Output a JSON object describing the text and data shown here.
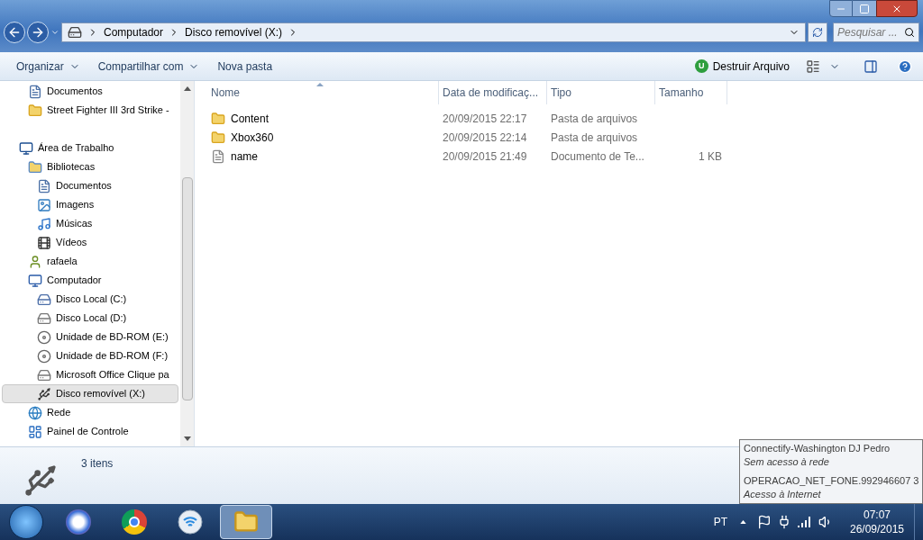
{
  "address_bar": {
    "breadcrumbs": [
      "Computador",
      "Disco removível (X:)"
    ],
    "search": {
      "placeholder": "Pesquisar ..."
    }
  },
  "toolbar": {
    "buttons": [
      {
        "label": "Organizar",
        "dropdown": true
      },
      {
        "label": "Compartilhar com",
        "dropdown": true
      },
      {
        "label": "Nova pasta",
        "dropdown": false
      }
    ],
    "extension": {
      "badge": "U",
      "label": "Destruir Arquivo"
    }
  },
  "navigation": {
    "pinned": [
      {
        "label": "Documentos",
        "kind": "document"
      },
      {
        "label": "Street Fighter III 3rd Strike - ",
        "kind": "folder"
      }
    ],
    "tree": [
      {
        "label": "Área de Trabalho",
        "kind": "desktop",
        "selected": false,
        "children": [
          {
            "label": "Bibliotecas",
            "kind": "library",
            "selected": false,
            "children": [
              {
                "label": "Documentos",
                "kind": "document",
                "selected": false
              },
              {
                "label": "Imagens",
                "kind": "image",
                "selected": false
              },
              {
                "label": "Músicas",
                "kind": "music",
                "selected": false
              },
              {
                "label": "Vídeos",
                "kind": "video",
                "selected": false
              }
            ]
          },
          {
            "label": "rafaela",
            "kind": "user",
            "selected": false
          },
          {
            "label": "Computador",
            "kind": "computer",
            "selected": false,
            "children": [
              {
                "label": "Disco Local (C:)",
                "kind": "system-drive",
                "selected": false
              },
              {
                "label": "Disco Local (D:)",
                "kind": "drive",
                "selected": false
              },
              {
                "label": "Unidade de BD-ROM (E:)",
                "kind": "optical",
                "selected": false
              },
              {
                "label": "Unidade de BD-ROM (F:)",
                "kind": "optical",
                "selected": false
              },
              {
                "label": "Microsoft Office Clique pa",
                "kind": "drive",
                "selected": false
              },
              {
                "label": "Disco removível (X:)",
                "kind": "removable",
                "selected": true
              }
            ]
          },
          {
            "label": "Rede",
            "kind": "network",
            "selected": false
          },
          {
            "label": "Painel de Controle",
            "kind": "control-panel",
            "selected": false
          }
        ]
      }
    ]
  },
  "file_list": {
    "columns": [
      "Nome",
      "Data de modificaç...",
      "Tipo",
      "Tamanho"
    ],
    "rows": [
      {
        "name": "Content",
        "kind": "folder",
        "date": "20/09/2015 22:17",
        "type": "Pasta de arquivos"
      },
      {
        "name": "Xbox360",
        "kind": "folder",
        "date": "20/09/2015 22:14",
        "type": "Pasta de arquivos"
      },
      {
        "name": "name",
        "kind": "text-file",
        "date": "20/09/2015 21:49",
        "type": "Documento de Te...",
        "size": "1 KB"
      }
    ]
  },
  "details_pane": {
    "item_count": "3 itens"
  },
  "network_tooltip": [
    {
      "text": "Connectify-Washington DJ Pedro",
      "italic": false
    },
    {
      "text": "Sem acesso à rede",
      "italic": true
    },
    {
      "text": "OPERACAO_NET_FONE.992946607 3",
      "italic": false
    },
    {
      "text": "Acesso à Internet",
      "italic": true
    }
  ],
  "taskbar": {
    "apps": [
      {
        "kind": "browser-s",
        "active": false
      },
      {
        "kind": "chrome",
        "active": false
      },
      {
        "kind": "wifi",
        "active": false
      },
      {
        "kind": "explorer",
        "active": true
      }
    ],
    "language": "PT",
    "time": "07:07",
    "date": "26/09/2015"
  }
}
